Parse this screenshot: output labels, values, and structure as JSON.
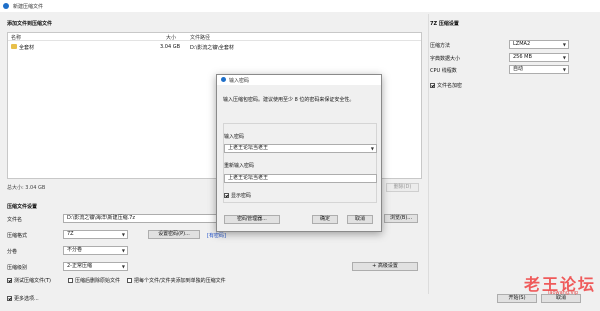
{
  "window": {
    "title": "新建压缩文件"
  },
  "files_section": {
    "title": "添加文件到压缩文件",
    "columns": [
      "名称",
      "大小",
      "文件路径"
    ],
    "rows": [
      {
        "name": "全套材",
        "size": "3.04 GB",
        "path": "D:\\影流之镰\\全套材"
      }
    ],
    "total_size": "总大小: 3.04 GB",
    "delete_label": "删除(D)"
  },
  "archive_section": {
    "title": "压缩文件设置",
    "filename_label": "文件名",
    "filename_value": "D:\\影流之镰\\海洋\\新建压缩.7z",
    "browse_label": "浏览(B)...",
    "format_label": "压缩格式",
    "format_value": "7Z",
    "set_password_label": "设置密码(P)...",
    "password_status": "[有密码]",
    "split_label": "分卷",
    "split_value": "不分卷",
    "level_label": "压缩级别",
    "level_value": "2-正常压缩",
    "advanced_label": "+ 高级设置",
    "test_label": "测试压缩文件(T)",
    "delete_source_label": "压缩后删除原始文件",
    "each_file_label": "把每个文件/文件夹添加到单独的压缩文件",
    "more_label": "更多选项..."
  },
  "z7_settings": {
    "title": "7Z 压缩设置",
    "method_label": "压缩方法",
    "method_value": "LZMA2",
    "dict_label": "字典数据大小",
    "dict_value": "256 MB",
    "cpu_label": "CPU 线程数",
    "cpu_value": "自动",
    "encrypt_names_label": "文件名加密"
  },
  "footer": {
    "start_label": "开始(S)",
    "cancel_label": "取消"
  },
  "dialog": {
    "title": "输入密码",
    "hint": "输入压缩包密码。建议使用至少 8 位的密码来保证安全性。",
    "password_label": "输入密码",
    "password_value": "上老王论坛当老王",
    "confirm_label": "重新输入密码",
    "confirm_value": "上老王论坛当老王",
    "show_password_label": "显示密码",
    "manager_label": "密码管理器...",
    "ok_label": "确定",
    "cancel_label": "取消"
  },
  "watermark": {
    "main": "老王论坛",
    "sub": "laowang.vip"
  }
}
